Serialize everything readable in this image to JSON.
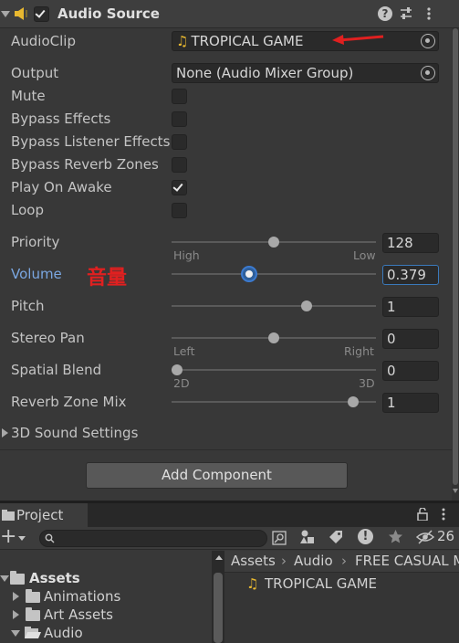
{
  "inspector": {
    "component_title": "Audio Source",
    "component_enabled": true,
    "header_icons": [
      "help-icon",
      "preset-icon",
      "menu-icon"
    ],
    "fields": {
      "audioclip": {
        "label": "AudioClip",
        "value": "TROPICAL GAME",
        "icon": "audio-clip-icon"
      },
      "output": {
        "label": "Output",
        "value": "None (Audio Mixer Group)"
      },
      "mute": {
        "label": "Mute",
        "checked": false
      },
      "bypass_effects": {
        "label": "Bypass Effects",
        "checked": false
      },
      "bypass_listener": {
        "label": "Bypass Listener Effects",
        "checked": false
      },
      "bypass_reverb": {
        "label": "Bypass Reverb Zones",
        "checked": false
      },
      "play_on_awake": {
        "label": "Play On Awake",
        "checked": true
      },
      "loop": {
        "label": "Loop",
        "checked": false
      },
      "priority": {
        "label": "Priority",
        "value": "128",
        "min_label": "High",
        "max_label": "Low",
        "fraction": 0.5
      },
      "volume": {
        "label": "Volume",
        "value": "0.379",
        "fraction": 0.379,
        "annotation": "音量"
      },
      "pitch": {
        "label": "Pitch",
        "value": "1",
        "fraction": 0.67
      },
      "stereo_pan": {
        "label": "Stereo Pan",
        "value": "0",
        "min_label": "Left",
        "max_label": "Right",
        "fraction": 0.5
      },
      "spatial_blend": {
        "label": "Spatial Blend",
        "value": "0",
        "min_label": "2D",
        "max_label": "3D",
        "fraction": 0.0
      },
      "reverb_zone_mix": {
        "label": "Reverb Zone Mix",
        "value": "1",
        "fraction": 0.91
      }
    },
    "sound_settings_label": "3D Sound Settings",
    "add_component_label": "Add Component"
  },
  "project": {
    "tab_label": "Project",
    "hidden_count": "26",
    "breadcrumb": [
      "Assets",
      "Audio",
      "FREE CASUAL M"
    ],
    "tree": [
      {
        "label": "Assets",
        "bold": true,
        "expanded": true
      },
      {
        "label": "Animations",
        "expanded": false
      },
      {
        "label": "Art Assets",
        "expanded": false
      },
      {
        "label": "Audio",
        "expanded": true
      }
    ],
    "files": [
      {
        "label": "TROPICAL GAME",
        "icon": "audio-clip-icon"
      }
    ]
  },
  "colors": {
    "background": "#383838",
    "annotation_red": "#e02020",
    "selected_blue": "#3b7ad0",
    "audio_icon_yellow": "#e8b830"
  }
}
